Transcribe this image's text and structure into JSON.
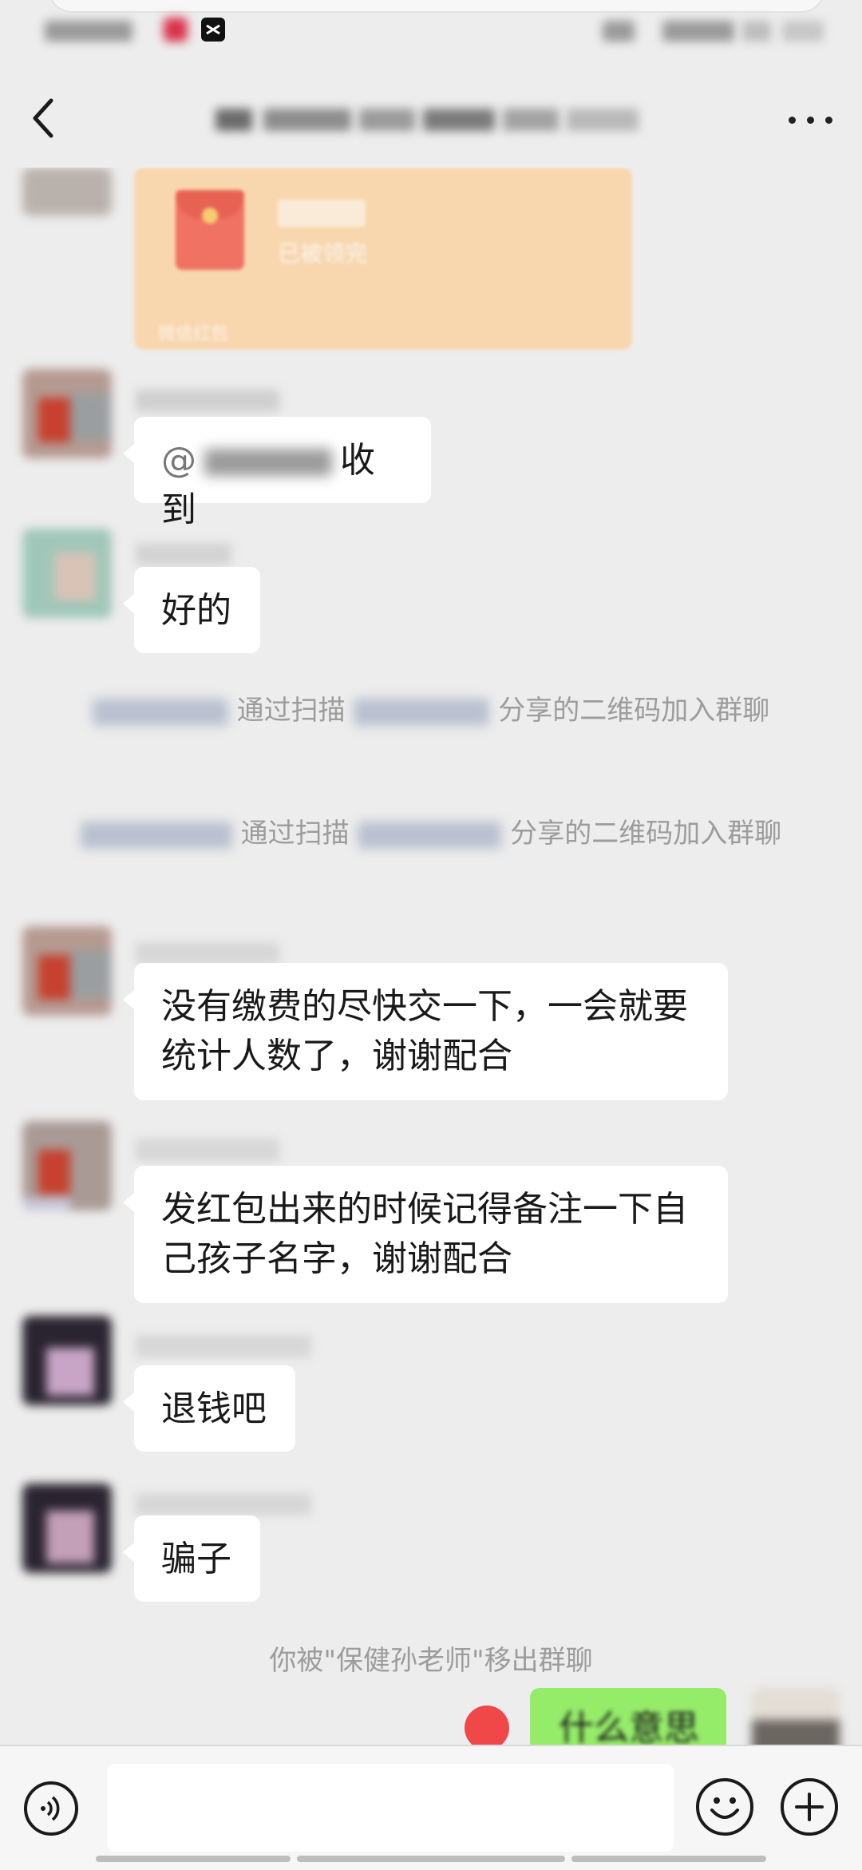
{
  "colors": {
    "background": "#ededed",
    "bubble_other": "#ffffff",
    "bubble_self": "#95ec69",
    "system_text": "#9c9c9c",
    "red_packet": "#fbd3a4"
  },
  "status_bar": {
    "icons": [
      "app-icon-red",
      "capcut-icon",
      "wifi-icon",
      "battery-icon"
    ]
  },
  "nav": {
    "back_icon": "chevron-left-icon",
    "more_icon": "ellipsis-icon"
  },
  "red_packet": {
    "status": "已被领完",
    "footer": "微信红包"
  },
  "messages": [
    {
      "id": "m1",
      "mention_prefix": "@",
      "text": "收到"
    },
    {
      "id": "m2",
      "text": "好的"
    },
    {
      "id": "s1",
      "system_visible": "通过扫描",
      "system_suffix": "分享的二维码加入群聊"
    },
    {
      "id": "s2",
      "system_visible": "通过扫描",
      "system_suffix": "分享的二维码加入群聊"
    },
    {
      "id": "m3",
      "text_line1": "没有缴费的尽快交一下，一会就要",
      "text_line2": "统计人数了，谢谢配合"
    },
    {
      "id": "m4",
      "text_line1": "发红包出来的时候记得备注一下自",
      "text_line2": "己孩子名字，谢谢配合"
    },
    {
      "id": "m5",
      "text": "退钱吧"
    },
    {
      "id": "m6",
      "text": "骗子"
    },
    {
      "id": "s3",
      "system_text": "你被\"保健孙老师\"移出群聊"
    }
  ],
  "self_message": {
    "text": "什么意思"
  },
  "input_bar": {
    "voice_icon": "voice-icon",
    "emoji_icon": "emoji-icon",
    "plus_icon": "plus-icon"
  }
}
